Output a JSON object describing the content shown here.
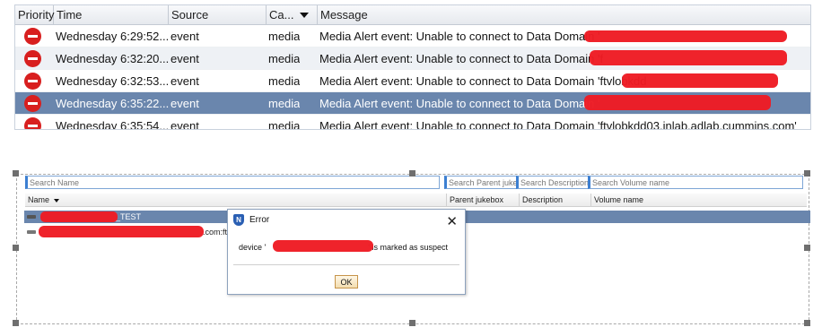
{
  "alerts": {
    "columns": [
      "Priority",
      "Time",
      "Source",
      "Ca...",
      "Message"
    ],
    "rows": [
      {
        "time": "Wednesday 6:29:52...",
        "source": "event",
        "category": "media",
        "message": "Media Alert event: Unable to connect to Data Domain '"
      },
      {
        "time": "Wednesday 6:32:20...",
        "source": "event",
        "category": "media",
        "message": "Media Alert event: Unable to connect to Data Domain 'f"
      },
      {
        "time": "Wednesday 6:32:53...",
        "source": "event",
        "category": "media",
        "message": "Media Alert event: Unable to connect to Data Domain 'ftvlobkdd"
      },
      {
        "time": "Wednesday 6:35:22...",
        "source": "event",
        "category": "media",
        "message": "Media Alert event: Unable to connect to Data Domain '"
      },
      {
        "time": "Wednesday 6:35:54...",
        "source": "event",
        "category": "media",
        "message": "Media Alert event: Unable to connect to Data Domain 'ftvlobkdd03.inlab.adlab.cummins.com'"
      }
    ]
  },
  "jukebox": {
    "search": {
      "name_placeholder": "Search Name",
      "parent_placeholder": "Search Parent jukebox",
      "description_placeholder": "Search Description",
      "volume_placeholder": "Search Volume name"
    },
    "columns": {
      "name": "Name",
      "parent": "Parent jukebox",
      "description": "Description",
      "volume": "Volume name"
    },
    "rows": [
      {
        "name": "_TEST"
      },
      {
        "name": ".com:ftv"
      }
    ]
  },
  "dialog": {
    "title": "Error",
    "message_prefix": "device '",
    "message_suffix": "' is marked as suspect",
    "ok_label": "OK"
  },
  "colors": {
    "selection": "#6a86ad",
    "priority_critical": "#d81f1f",
    "redaction": "#ee1c24"
  }
}
